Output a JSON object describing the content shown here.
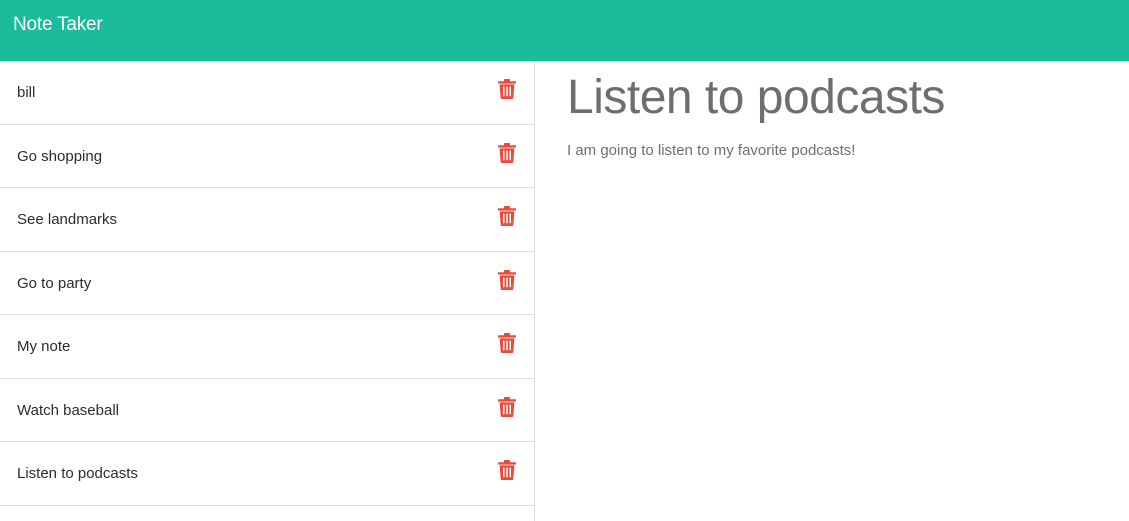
{
  "app": {
    "title": "Note Taker",
    "accent_color": "#1abc9c",
    "delete_icon_color": "#e74c3c"
  },
  "notes": [
    {
      "title": "bill",
      "icon": "trash-icon"
    },
    {
      "title": "Go shopping",
      "icon": "trash-icon"
    },
    {
      "title": "See landmarks",
      "icon": "trash-icon"
    },
    {
      "title": "Go to party",
      "icon": "trash-icon"
    },
    {
      "title": "My note",
      "icon": "trash-icon"
    },
    {
      "title": "Watch baseball",
      "icon": "trash-icon"
    },
    {
      "title": "Listen to podcasts",
      "icon": "trash-icon"
    }
  ],
  "active_note": {
    "title": "Listen to podcasts",
    "text": "I am going to listen to my favorite podcasts!"
  }
}
